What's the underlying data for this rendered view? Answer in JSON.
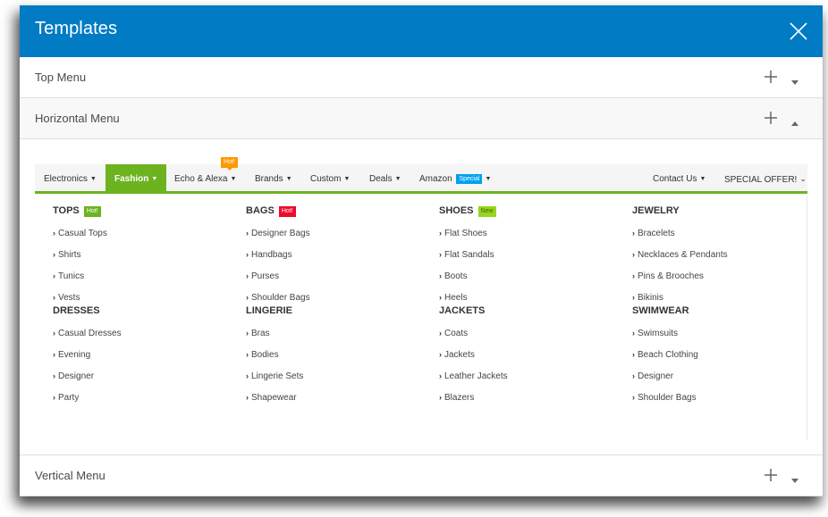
{
  "window": {
    "title": "Templates",
    "close_icon": "close-icon"
  },
  "colors": {
    "titlebar": "#017bc4",
    "menu_accent": "#6cb31f",
    "badge_hot_orange": "#ff9700",
    "badge_special_blue": "#00a2ef",
    "badge_hot_red": "#ef0b2c",
    "badge_new_green": "#95d521"
  },
  "sections": {
    "top_menu": {
      "label": "Top Menu",
      "add_icon": "plus-icon",
      "toggle_icon": "caret-down-icon",
      "expanded": false
    },
    "horizontal_menu": {
      "label": "Horizontal Menu",
      "add_icon": "plus-icon",
      "toggle_icon": "caret-up-icon",
      "expanded": true
    },
    "vertical_menu": {
      "label": "Vertical Menu",
      "add_icon": "plus-icon",
      "toggle_icon": "caret-down-icon",
      "expanded": false
    }
  },
  "menubar": {
    "items": [
      {
        "label": "Electronics",
        "arrow": "▼"
      },
      {
        "label": "Fashion",
        "arrow": "▼",
        "active": true
      },
      {
        "label": "Echo & Alexa",
        "arrow": "▼",
        "badge": "Hot!"
      },
      {
        "label": "Brands",
        "arrow": "▼"
      },
      {
        "label": "Custom",
        "arrow": "▼"
      },
      {
        "label": "Deals",
        "arrow": "▼"
      },
      {
        "label": "Amazon",
        "arrow": "▼",
        "badge": "Special"
      },
      {
        "label": "Contact Us",
        "arrow": "▼"
      },
      {
        "label": "SPECIAL OFFER!",
        "arrow": "⌄"
      }
    ]
  },
  "dropdown": {
    "columns": [
      {
        "groups": [
          {
            "title": "TOPS",
            "badge": "Hot!",
            "links": [
              "Casual Tops",
              "Shirts",
              "Tunics",
              "Vests"
            ]
          },
          {
            "title": "DRESSES",
            "links": [
              "Casual Dresses",
              "Evening",
              "Designer",
              "Party"
            ]
          }
        ]
      },
      {
        "groups": [
          {
            "title": "BAGS",
            "badge": "Hot!",
            "links": [
              "Designer Bags",
              "Handbags",
              "Purses",
              "Shoulder Bags"
            ]
          },
          {
            "title": "LINGERIE",
            "links": [
              "Bras",
              "Bodies",
              "Lingerie Sets",
              "Shapewear"
            ]
          }
        ]
      },
      {
        "groups": [
          {
            "title": "SHOES",
            "badge": "New",
            "links": [
              "Flat Shoes",
              "Flat Sandals",
              "Boots",
              "Heels"
            ]
          },
          {
            "title": "JACKETS",
            "links": [
              "Coats",
              "Jackets",
              "Leather Jackets",
              "Blazers"
            ]
          }
        ]
      },
      {
        "groups": [
          {
            "title": "JEWELRY",
            "links": [
              "Bracelets",
              "Necklaces & Pendants",
              "Pins & Brooches",
              "Bikinis"
            ]
          },
          {
            "title": "SWIMWEAR",
            "links": [
              "Swimsuits",
              "Beach Clothing",
              "Designer",
              "Shoulder Bags"
            ]
          }
        ]
      }
    ],
    "link_chevron": "›"
  }
}
